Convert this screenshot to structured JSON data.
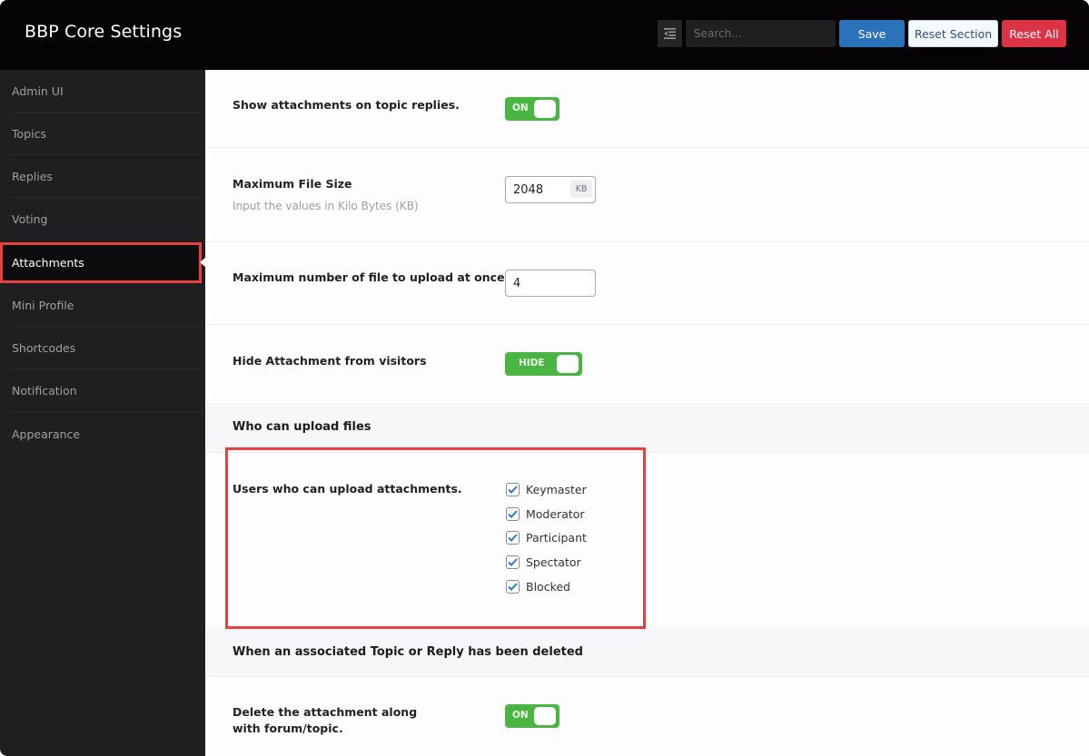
{
  "header": {
    "title": "BBP Core Settings",
    "search_placeholder": "Search...",
    "save_label": "Save",
    "reset_section_label": "Reset Section",
    "reset_all_label": "Reset All",
    "collapse_icon": "indent-icon"
  },
  "colors": {
    "save": "#2a73bb",
    "reset_all": "#dc3445",
    "toggle_on": "#4bb543",
    "highlight": "#e8403f"
  },
  "sidebar": {
    "items": [
      {
        "label": "Admin UI",
        "active": false
      },
      {
        "label": "Topics",
        "active": false
      },
      {
        "label": "Replies",
        "active": false
      },
      {
        "label": "Voting",
        "active": false
      },
      {
        "label": "Attachments",
        "active": true
      },
      {
        "label": "Mini Profile",
        "active": false
      },
      {
        "label": "Shortcodes",
        "active": false
      },
      {
        "label": "Notification",
        "active": false
      },
      {
        "label": "Appearance",
        "active": false
      }
    ]
  },
  "settings": {
    "show_attachments": {
      "label": "Show attachments on topic replies.",
      "toggle_label": "ON",
      "value": true
    },
    "max_file_size": {
      "label": "Maximum File Size",
      "description": "Input the values in Kilo Bytes (KB)",
      "value": "2048",
      "unit": "KB"
    },
    "max_files": {
      "label": "Maximum number of file to upload at once",
      "value": "4"
    },
    "hide_from_visitors": {
      "label": "Hide Attachment from visitors",
      "toggle_label": "HIDE",
      "value": true
    },
    "who_can_upload": {
      "section_title": "Who can upload files",
      "label": "Users who can upload attachments.",
      "roles": [
        {
          "label": "Keymaster",
          "checked": true
        },
        {
          "label": "Moderator",
          "checked": true
        },
        {
          "label": "Participant",
          "checked": true
        },
        {
          "label": "Spectator",
          "checked": true
        },
        {
          "label": "Blocked",
          "checked": true
        }
      ]
    },
    "on_delete": {
      "section_title": "When an associated Topic or Reply has been deleted",
      "label": "Delete the attachment along with forum/topic.",
      "toggle_label": "ON",
      "value": true
    }
  }
}
